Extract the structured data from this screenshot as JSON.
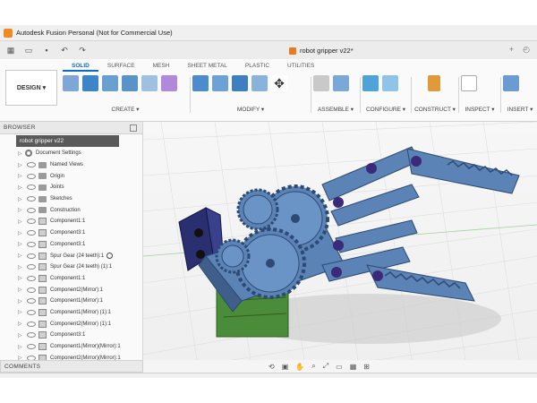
{
  "window": {
    "title": "Autodesk Fusion Personal (Not for Commercial Use)"
  },
  "document": {
    "tab_title": "robot gripper v22*"
  },
  "workspace": {
    "label": "DESIGN ▾"
  },
  "tabs": [
    {
      "label": "SOLID",
      "active": true
    },
    {
      "label": "SURFACE",
      "active": false
    },
    {
      "label": "MESH",
      "active": false
    },
    {
      "label": "SHEET METAL",
      "active": false
    },
    {
      "label": "PLASTIC",
      "active": false
    },
    {
      "label": "UTILITIES",
      "active": false
    }
  ],
  "tool_groups": {
    "create": "CREATE ▾",
    "modify": "MODIFY ▾",
    "assemble": "ASSEMBLE ▾",
    "configure": "CONFIGURE ▾",
    "construct": "CONSTRUCT ▾",
    "inspect": "INSPECT ▾",
    "insert": "INSERT ▾"
  },
  "browser": {
    "header": "BROWSER",
    "root": "robot gripper v22",
    "items": [
      {
        "label": "Document Settings",
        "type": "gear"
      },
      {
        "label": "Named Views",
        "type": "folder"
      },
      {
        "label": "Origin",
        "type": "folder"
      },
      {
        "label": "Joints",
        "type": "folder"
      },
      {
        "label": "Sketches",
        "type": "folder"
      },
      {
        "label": "Construction",
        "type": "folder"
      },
      {
        "label": "Component1:1",
        "type": "comp"
      },
      {
        "label": "Component3:1",
        "type": "comp"
      },
      {
        "label": "Component3:1",
        "type": "comp"
      },
      {
        "label": "Spur Gear (24 teeth):1",
        "type": "comp"
      },
      {
        "label": "Spur Gear (24 teeth) (1):1",
        "type": "comp"
      },
      {
        "label": "Component1:1",
        "type": "comp"
      },
      {
        "label": "Component2(Mirror):1",
        "type": "comp"
      },
      {
        "label": "Component1(Mirror):1",
        "type": "comp"
      },
      {
        "label": "Component1(Mirror) (1):1",
        "type": "comp"
      },
      {
        "label": "Component2(Mirror) (1):1",
        "type": "comp"
      },
      {
        "label": "Component3:1",
        "type": "comp"
      },
      {
        "label": "Component1(Mirror)(Mirror):1",
        "type": "comp"
      },
      {
        "label": "Component2(Mirror)(Mirror):1",
        "type": "comp"
      }
    ]
  },
  "comments": {
    "header": "COMMENTS"
  },
  "colors": {
    "gripper_blue": "#5b83b6",
    "gripper_blue_dark": "#3f5f8a",
    "motor_green": "#4b8c3a",
    "mount_navy": "#2a2f70",
    "accent": "#0a6ac7"
  }
}
